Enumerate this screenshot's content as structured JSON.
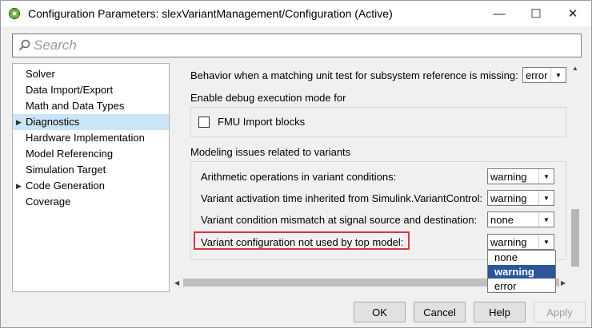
{
  "window": {
    "title": "Configuration Parameters: slexVariantManagement/Configuration (Active)"
  },
  "controls": {
    "minimize": "—",
    "maximize": "☐",
    "close": "✕"
  },
  "search": {
    "placeholder": "Search"
  },
  "tree": {
    "items": [
      {
        "label": "Solver",
        "expandable": false,
        "selected": false
      },
      {
        "label": "Data Import/Export",
        "expandable": false,
        "selected": false
      },
      {
        "label": "Math and Data Types",
        "expandable": false,
        "selected": false
      },
      {
        "label": "Diagnostics",
        "expandable": true,
        "selected": true
      },
      {
        "label": "Hardware Implementation",
        "expandable": false,
        "selected": false
      },
      {
        "label": "Model Referencing",
        "expandable": false,
        "selected": false
      },
      {
        "label": "Simulation Target",
        "expandable": false,
        "selected": false
      },
      {
        "label": "Code Generation",
        "expandable": true,
        "selected": false
      },
      {
        "label": "Coverage",
        "expandable": false,
        "selected": false
      }
    ]
  },
  "main": {
    "unit_test_label": "Behavior when a matching unit test for subsystem reference is missing:",
    "unit_test_value": "error",
    "debug_header": "Enable debug execution mode for",
    "fmu_label": "FMU Import blocks",
    "variants_header": "Modeling issues related to variants",
    "rows": [
      {
        "label": "Arithmetic operations in variant conditions:",
        "value": "warning"
      },
      {
        "label": "Variant activation time inherited from Simulink.VariantControl:",
        "value": "warning"
      },
      {
        "label": "Variant condition mismatch at signal source and destination:",
        "value": "none"
      },
      {
        "label": "Variant configuration not used by top model:",
        "value": "warning"
      }
    ],
    "options": [
      "none",
      "warning",
      "error"
    ],
    "selected_option": "warning"
  },
  "footer": {
    "ok": "OK",
    "cancel": "Cancel",
    "help": "Help",
    "apply": "Apply"
  },
  "colors": {
    "selection": "#cce4f7",
    "highlight_border": "#d9363e",
    "list_selection": "#2b579a"
  }
}
